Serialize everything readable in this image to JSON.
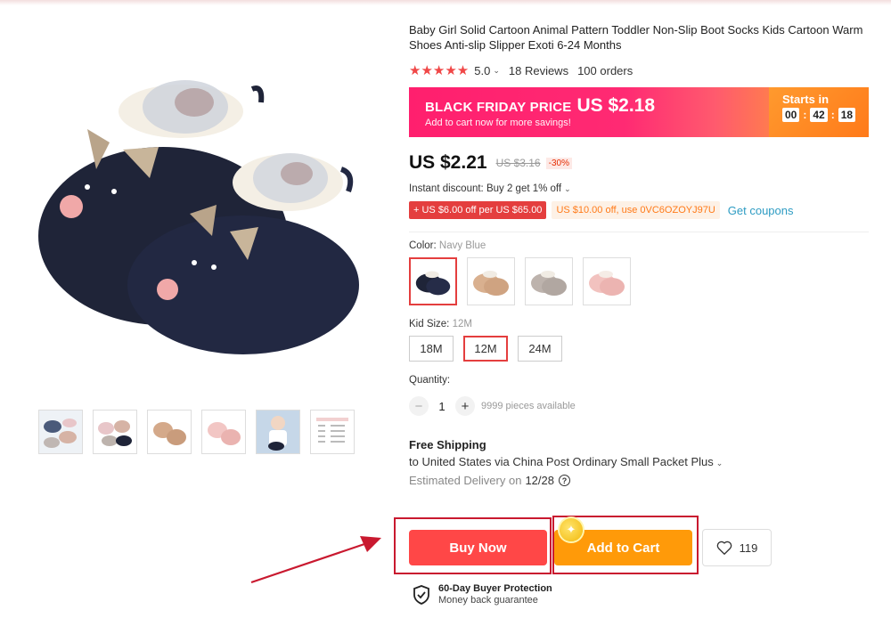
{
  "product": {
    "title": "Baby Girl Solid Cartoon Animal Pattern Toddler Non-Slip Boot Socks Kids Cartoon Warm Shoes Anti-slip Slipper Exoti 6-24 Months",
    "stars": "★★★★★",
    "rating": "5.0",
    "reviews": "18 Reviews",
    "orders": "100 orders"
  },
  "banner": {
    "label": "BLACK FRIDAY PRICE",
    "price": "US $2.18",
    "subtitle": "Add to cart now for more savings!",
    "starts_in": "Starts in",
    "timer": [
      "00",
      "42",
      "18"
    ]
  },
  "pricing": {
    "price": "US $2.21",
    "old_price": "US $3.16",
    "discount": "-30%",
    "instant_discount": "Instant discount: Buy 2 get 1% off",
    "coupon1": "+ US $6.00 off per US $65.00",
    "coupon2": "US $10.00 off, use 0VC6OZOYJ97U",
    "get_coupons": "Get coupons"
  },
  "color": {
    "label": "Color:",
    "selected": "Navy Blue"
  },
  "size": {
    "label": "Kid Size:",
    "selected": "12M",
    "options": [
      "18M",
      "12M",
      "24M"
    ]
  },
  "quantity": {
    "label": "Quantity:",
    "value": "1",
    "minus": "−",
    "plus": "+",
    "available": "9999 pieces available"
  },
  "shipping": {
    "title": "Free Shipping",
    "via": "to United States via China Post Ordinary Small Packet Plus",
    "estimated_label": "Estimated Delivery on",
    "estimated_date": "12/28",
    "help": "?"
  },
  "actions": {
    "buy_now": "Buy Now",
    "add_to_cart": "Add to Cart",
    "wishlist_count": "119"
  },
  "protection": {
    "title": "60-Day Buyer Protection",
    "subtitle": "Money back guarantee"
  },
  "colors": {
    "accent_red": "#ff4747",
    "accent_orange": "#ff9a09",
    "banner_pink": "#ff1a6e",
    "annotation_red": "#c9192f"
  }
}
